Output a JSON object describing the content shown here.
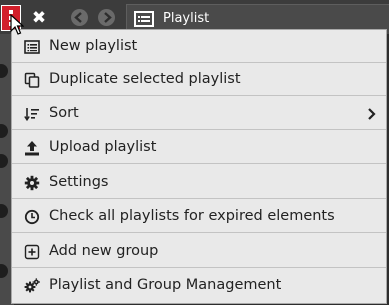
{
  "tab": {
    "title": "Playlist"
  },
  "menu": {
    "items": [
      {
        "label": "New playlist",
        "icon": "list-icon",
        "has_submenu": false
      },
      {
        "label": "Duplicate selected playlist",
        "icon": "copy-icon",
        "has_submenu": false
      },
      {
        "label": "Sort",
        "icon": "sort-icon",
        "has_submenu": true
      },
      {
        "label": "Upload playlist",
        "icon": "upload-icon",
        "has_submenu": false
      },
      {
        "label": "Settings",
        "icon": "gear-icon",
        "has_submenu": false
      },
      {
        "label": "Check all playlists for expired elements",
        "icon": "clock-icon",
        "has_submenu": false
      },
      {
        "label": "Add new group",
        "icon": "plus-square-icon",
        "has_submenu": false
      },
      {
        "label": "Playlist and Group Management",
        "icon": "gears-icon",
        "has_submenu": false
      }
    ]
  },
  "colors": {
    "accent": "#d21f2b",
    "menu_bg": "#e9e9e9",
    "topbar_bg": "#3c3c3c",
    "tab_bg": "#4a4a4a"
  }
}
